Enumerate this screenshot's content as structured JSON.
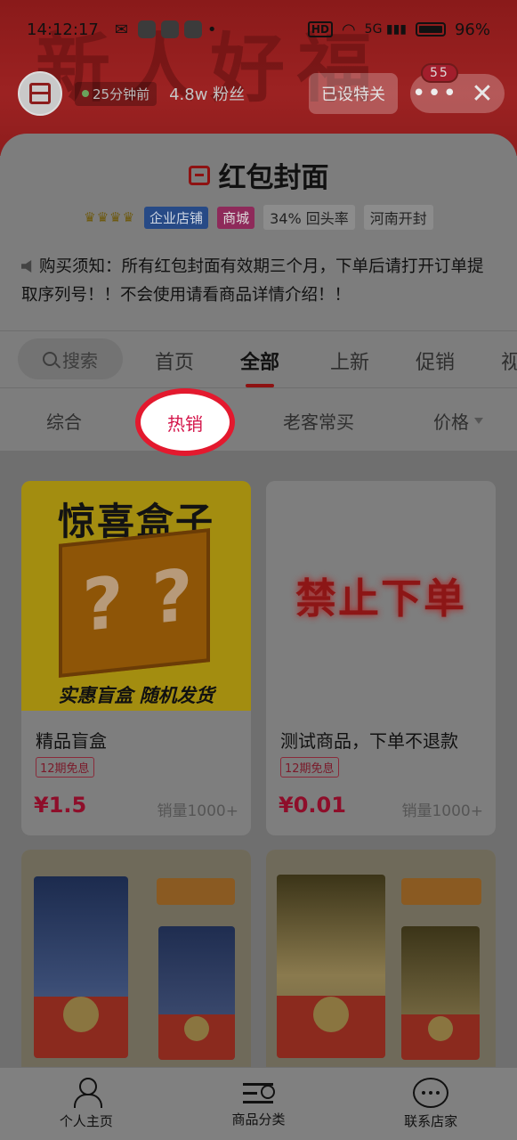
{
  "status_bar": {
    "time": "14:12:17",
    "network": "5G",
    "battery": "96%"
  },
  "shop_header": {
    "online_text": "25分钟前",
    "fans_text": "4.8w 粉丝",
    "follow_label": "已设特关",
    "more_badge": "55"
  },
  "shop": {
    "name": "红包封面",
    "tags": {
      "enterprise": "企业店铺",
      "mall": "商城",
      "repurchase": "34% 回头率",
      "location": "河南开封"
    },
    "notice": "购买须知：所有红包封面有效期三个月，下单后请打开订单提取序列号！！不会使用请看商品详情介绍！！"
  },
  "tabs": {
    "search": "搜索",
    "home": "首页",
    "all": "全部",
    "new": "上新",
    "promo": "促销",
    "video": "视"
  },
  "sorts": {
    "general": "综合",
    "hot": "热销",
    "regular": "老客常买",
    "price": "价格"
  },
  "products": [
    {
      "name": "精品盲盒",
      "installment": "12期免息",
      "price": "¥1.5",
      "sales": "销量1000+",
      "image_headline": "惊喜盒子",
      "image_footer": "实惠盲盒 随机发货"
    },
    {
      "name": "测试商品，下单不退款",
      "installment": "12期免息",
      "price": "¥0.01",
      "sales": "销量1000+",
      "image_text": "禁止下单"
    }
  ],
  "bottom_nav": {
    "profile": "个人主页",
    "category": "商品分类",
    "contact": "联系店家"
  }
}
